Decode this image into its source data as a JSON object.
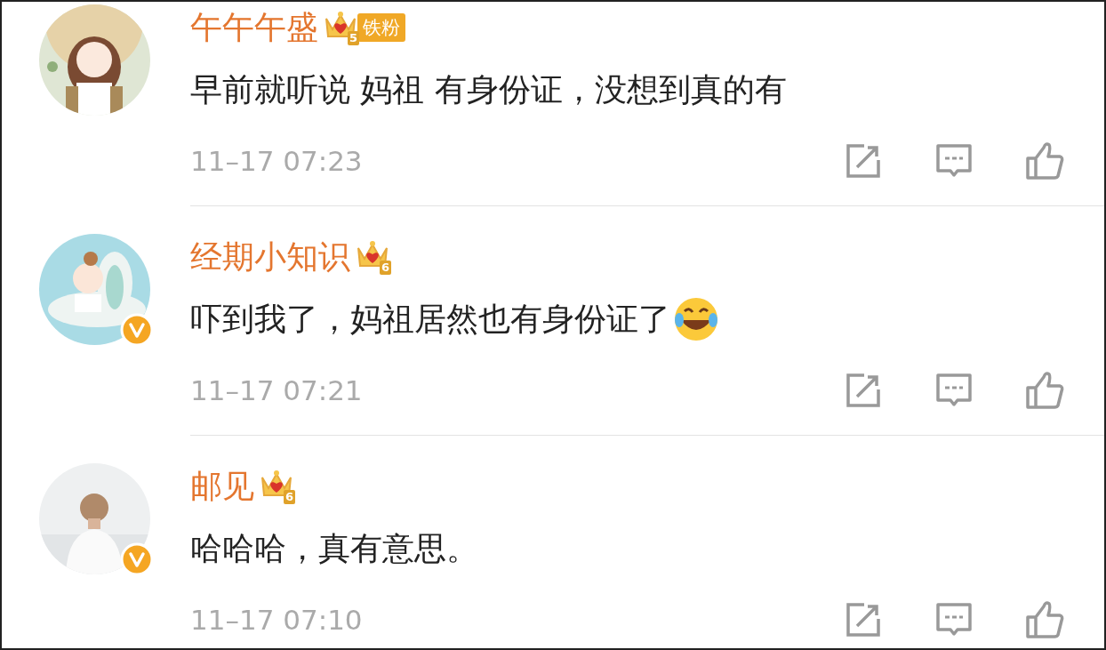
{
  "comments": [
    {
      "user": "午午午盛",
      "level": "5",
      "fan_tag": "铁粉",
      "verified": false,
      "text": "早前就听说 妈祖 有身份证，没想到真的有",
      "trailing_emoji": false,
      "time": "11–17 07:23"
    },
    {
      "user": "经期小知识",
      "level": "6",
      "verified": true,
      "text": "吓到我了，妈祖居然也有身份证了",
      "trailing_emoji": true,
      "time": "11–17 07:21"
    },
    {
      "user": "邮见",
      "level": "6",
      "verified": true,
      "text": "哈哈哈，真有意思。",
      "trailing_emoji": false,
      "time": "11–17 07:10"
    }
  ]
}
